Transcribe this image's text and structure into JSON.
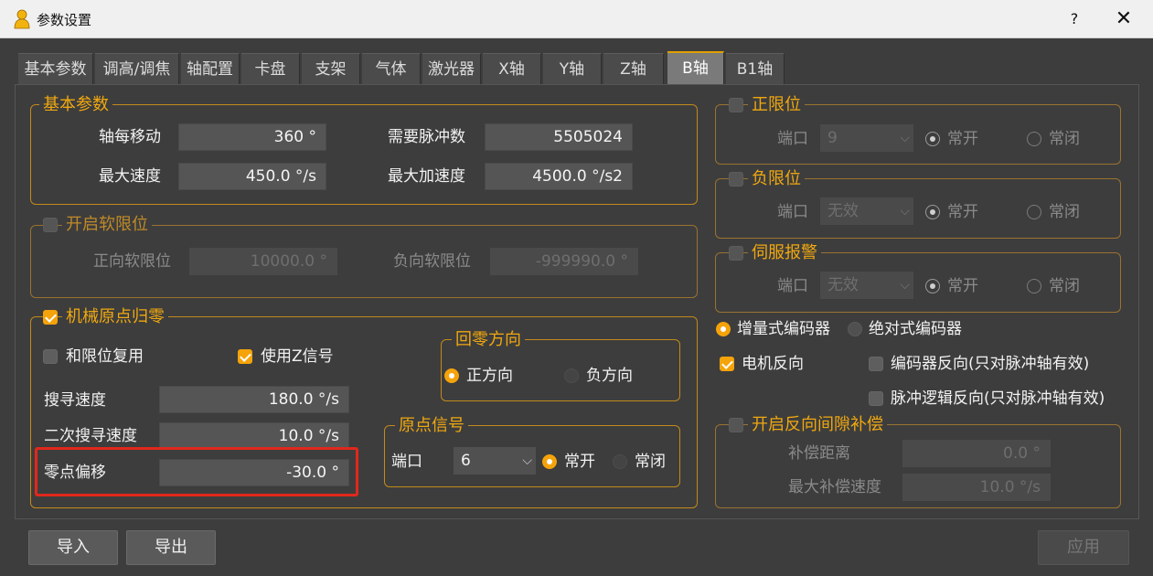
{
  "window": {
    "title": "参数设置",
    "help": "?",
    "close": "✕"
  },
  "tabs": [
    "基本参数",
    "调高/调焦",
    "轴配置",
    "卡盘",
    "支架",
    "气体",
    "激光器",
    "X轴",
    "Y轴",
    "Z轴",
    "B轴",
    "B1轴"
  ],
  "active_tab": "B轴",
  "basic": {
    "title": "基本参数",
    "move_per_axis_label": "轴每移动",
    "move_per_axis_value": "360 °",
    "pulse_label": "需要脉冲数",
    "pulse_value": "5505024",
    "max_speed_label": "最大速度",
    "max_speed_value": "450.0 °/s",
    "max_acc_label": "最大加速度",
    "max_acc_value": "4500.0 °/s2"
  },
  "soft_limit": {
    "title": "开启软限位",
    "pos_label": "正向软限位",
    "pos_value": "10000.0 °",
    "neg_label": "负向软限位",
    "neg_value": "-999990.0 °"
  },
  "homing": {
    "title": "机械原点归零",
    "reuse_limit_label": "和限位复用",
    "use_z_label": "使用Z信号",
    "search_speed_label": "搜寻速度",
    "search_speed_value": "180.0 °/s",
    "second_search_label": "二次搜寻速度",
    "second_search_value": "10.0 °/s",
    "offset_label": "零点偏移",
    "offset_value": "-30.0 °",
    "direction": {
      "title": "回零方向",
      "positive": "正方向",
      "negative": "负方向"
    },
    "signal": {
      "title": "原点信号",
      "port_label": "端口",
      "port_value": "6",
      "no": "常开",
      "nc": "常闭"
    }
  },
  "pos_limit": {
    "title": "正限位",
    "port_label": "端口",
    "port_value": "9",
    "no": "常开",
    "nc": "常闭"
  },
  "neg_limit": {
    "title": "负限位",
    "port_label": "端口",
    "port_value": "无效",
    "no": "常开",
    "nc": "常闭"
  },
  "servo_alarm": {
    "title": "伺服报警",
    "port_label": "端口",
    "port_value": "无效",
    "no": "常开",
    "nc": "常闭"
  },
  "encoder": {
    "incremental": "增量式编码器",
    "absolute": "绝对式编码器",
    "motor_reverse": "电机反向",
    "encoder_reverse": "编码器反向(只对脉冲轴有效)",
    "pulse_logic_reverse": "脉冲逻辑反向(只对脉冲轴有效)"
  },
  "backlash": {
    "title": "开启反向间隙补偿",
    "distance_label": "补偿距离",
    "distance_value": "0.0 °",
    "max_speed_label": "最大补偿速度",
    "max_speed_value": "10.0 °/s"
  },
  "buttons": {
    "import": "导入",
    "export": "导出",
    "apply": "应用"
  },
  "colors": {
    "accent": "#f5a30a",
    "highlight": "#e0281c"
  }
}
